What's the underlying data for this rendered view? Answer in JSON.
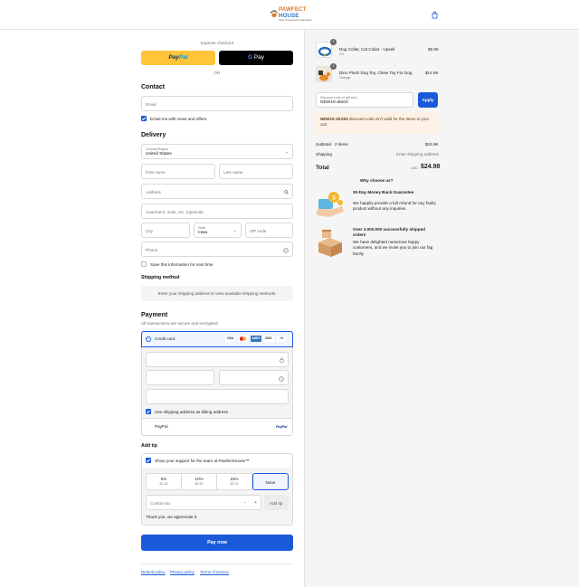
{
  "header": {
    "logo_line1": "PAWFECT",
    "logo_line2": "HOUSE",
    "logo_tagline": "Paws & Happiness Guaranteed"
  },
  "express": {
    "title": "Express checkout",
    "paypal_part1": "Pay",
    "paypal_part2": "Pal",
    "gpay_g": "G",
    "gpay_label": "Pay",
    "or": "OR"
  },
  "contact": {
    "heading": "Contact",
    "email_placeholder": "Email",
    "email_news_label": "Email me with news and offers"
  },
  "delivery": {
    "heading": "Delivery",
    "country_label": "Country/Region",
    "country_value": "United States",
    "first_name_placeholder": "First name",
    "last_name_placeholder": "Last name",
    "address_placeholder": "Address",
    "apartment_placeholder": "Apartment, suite, etc. (optional)",
    "city_placeholder": "City",
    "state_label": "State",
    "state_value": "Iowa",
    "zip_placeholder": "ZIP code",
    "phone_placeholder": "Phone",
    "save_info_label": "Save this information for next time"
  },
  "shipping_method": {
    "heading": "Shipping method",
    "message": "Enter your shipping address to view available shipping methods."
  },
  "payment": {
    "heading": "Payment",
    "subtext": "All transactions are secure and encrypted.",
    "credit_card_label": "Credit card",
    "card_logos": [
      "VISA",
      "MC",
      "AMEX",
      "DISC",
      "+4"
    ],
    "billing_label": "Use shipping address as billing address",
    "paypal_label": "PayPal",
    "paypal_logo": "PayPal"
  },
  "tip": {
    "heading": "Add tip",
    "support_label": "Show your support for the team at PawfectHouse™",
    "options": [
      {
        "percent": "5%",
        "amount": "$1.25"
      },
      {
        "percent": "10%",
        "amount": "$2.50"
      },
      {
        "percent": "15%",
        "amount": "$3.75"
      },
      {
        "percent": "None",
        "amount": ""
      }
    ],
    "custom_placeholder": "Custom tip",
    "add_tip_label": "Add tip",
    "thanks": "Thank you, we appreciate it."
  },
  "pay_now": "Pay now",
  "footer_links": [
    "Refund policy",
    "Privacy policy",
    "Terms of service"
  ],
  "summary": {
    "items": [
      {
        "name": "Dog Collar, Cat Collar - Upsell",
        "variant": "XS",
        "price": "$9.99",
        "qty": "1"
      },
      {
        "name": "Dino Plush Dog Toy, Chew Toy For Dog",
        "variant": "Orange",
        "price": "$14.99",
        "qty": "1"
      }
    ],
    "discount_label": "Discount code or gift card",
    "discount_value": "NEW10-Jks03",
    "apply_label": "Apply",
    "warning_code": "NEW10-JKS03",
    "warning_text": "discount code isn't valid for the items in your cart",
    "subtotal_label": "Subtotal · 2 items",
    "subtotal_value": "$24.98",
    "shipping_label": "Shipping",
    "shipping_value": "Enter shipping address",
    "total_label": "Total",
    "total_currency": "USD",
    "total_value": "$24.98",
    "why_heading": "Why choose us?",
    "benefits": [
      {
        "title": "30-Day Money Back Guarantee",
        "text": "We happily provide a full refund for any faulty product without any inquiries."
      },
      {
        "title": "Over 3.000.000 successfully shipped orders",
        "text": "We have delighted numerous happy customers, and we invite you to join our fag family"
      }
    ]
  },
  "colors": {
    "accent": "#1a5ad9",
    "paypal": "#ffc439",
    "warning_bg": "#fdf1e6"
  }
}
